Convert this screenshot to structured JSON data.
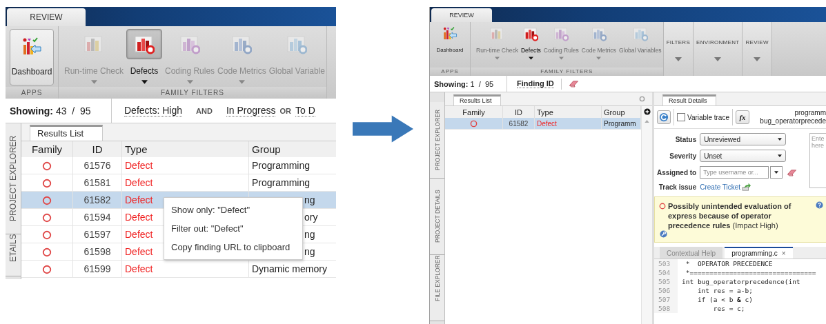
{
  "left": {
    "ribbon": {
      "tab": "REVIEW",
      "apps_group": "APPS",
      "dashboard": "Dashboard",
      "filters_group": "FAMILY FILTERS",
      "filters": [
        {
          "label": "Run-time Check",
          "kind": "runtime",
          "selected": false,
          "dropdown": true
        },
        {
          "label": "Defects",
          "kind": "defects",
          "selected": true,
          "dropdown": true
        },
        {
          "label": "Coding Rules",
          "kind": "coding",
          "selected": false,
          "dropdown": true
        },
        {
          "label": "Code Metrics",
          "kind": "metrics",
          "selected": false,
          "dropdown": true
        },
        {
          "label": "Global Variable",
          "kind": "globals",
          "selected": false,
          "dropdown": false
        }
      ]
    },
    "showing": "**Showing:** 43  /  95",
    "conditions": [
      {
        "kind": "filter",
        "text": "Defects: High"
      },
      {
        "kind": "operator",
        "text": "AND"
      },
      {
        "kind": "filter",
        "text": "In Progress"
      },
      {
        "kind": "operator",
        "text": "OR"
      },
      {
        "kind": "filter",
        "text": "To D"
      }
    ],
    "side_tabs": [
      "PROJECT EXPLORER",
      "ETAILS"
    ],
    "results_tab": "Results List",
    "columns": [
      "Family",
      "ID",
      "Type",
      "Group"
    ],
    "rows": [
      {
        "id": "61576",
        "type": "Defect",
        "group": "Programming",
        "selected": false,
        "covered": false
      },
      {
        "id": "61581",
        "type": "Defect",
        "group": "Programming",
        "selected": false,
        "covered": false
      },
      {
        "id": "61582",
        "type": "Defect",
        "group": "ng",
        "selected": true,
        "covered": true
      },
      {
        "id": "61594",
        "type": "Defect",
        "group": "ory",
        "selected": false,
        "covered": true
      },
      {
        "id": "61597",
        "type": "Defect",
        "group": "ng",
        "selected": false,
        "covered": true
      },
      {
        "id": "61598",
        "type": "Defect",
        "group": "ng",
        "selected": false,
        "covered": true
      },
      {
        "id": "61599",
        "type": "Defect",
        "group": "Dynamic memory",
        "selected": false,
        "covered": false
      }
    ],
    "context_menu": [
      "Show only: \"Defect\"",
      "Filter out: \"Defect\"",
      "Copy finding URL to clipboard"
    ]
  },
  "right": {
    "ribbon": {
      "tab": "REVIEW",
      "apps_group": "APPS",
      "dashboard": "Dashboard",
      "filters_group": "FAMILY FILTERS",
      "filters": [
        {
          "label": "Run-time Check",
          "kind": "runtime",
          "selected": false,
          "dropdown": true
        },
        {
          "label": "Defects",
          "kind": "defects",
          "selected": true,
          "dropdown": true
        },
        {
          "label": "Coding Rules",
          "kind": "coding",
          "selected": false,
          "dropdown": true
        },
        {
          "label": "Code Metrics",
          "kind": "metrics",
          "selected": false,
          "dropdown": true
        },
        {
          "label": "Global Variables",
          "kind": "globals",
          "selected": false,
          "dropdown": false
        }
      ],
      "menus": [
        "FILTERS",
        "ENVIRONMENT",
        "REVIEW"
      ]
    },
    "showing": "**Showing:** 1  /  95",
    "conditions": [
      {
        "kind": "filter",
        "text": "Finding ID"
      }
    ],
    "side_tabs": [
      "PROJECT EXPLORER",
      "PROJECT DETAILS",
      "FILE EXPLORER"
    ],
    "results_tab": "Results List",
    "columns": [
      "Family",
      "ID",
      "Type",
      "Group"
    ],
    "rows": [
      {
        "id": "61582",
        "type": "Defect",
        "group": "Programm",
        "selected": true
      }
    ],
    "details": {
      "tab": "Result Details",
      "variable_trace": {
        "label": "Variable trace",
        "checked": false
      },
      "fx": "fx",
      "file": "programm",
      "function": "bug_operatorprecede",
      "status_label": "Status",
      "status": "Unreviewed",
      "severity_label": "Severity",
      "severity": "Unset",
      "assigned_label": "Assigned to",
      "assigned_placeholder": "Type username or...",
      "track_label": "Track issue",
      "track_link": "Create Ticket",
      "comment_placeholder": "Ente here",
      "message": "**Possibly unintended evaluation of express because of operator precedence rules** (Impact High)"
    },
    "code_tabs": [
      {
        "label": "Contextual Help",
        "selected": false
      },
      {
        "label": "programming.c",
        "selected": true,
        "close": "×"
      }
    ],
    "code": [
      {
        "line": "503",
        "text": " *  OPERATOR PRECEDENCE"
      },
      {
        "line": "504",
        "text": " *================================"
      },
      {
        "line": "505",
        "text": "int bug_operatorprecedence(int"
      },
      {
        "line": "506",
        "text": "    int res = a-b;"
      },
      {
        "line": "507",
        "text": "    if (a < b **&** c)"
      },
      {
        "line": "508",
        "text": "        res = c;"
      }
    ]
  }
}
